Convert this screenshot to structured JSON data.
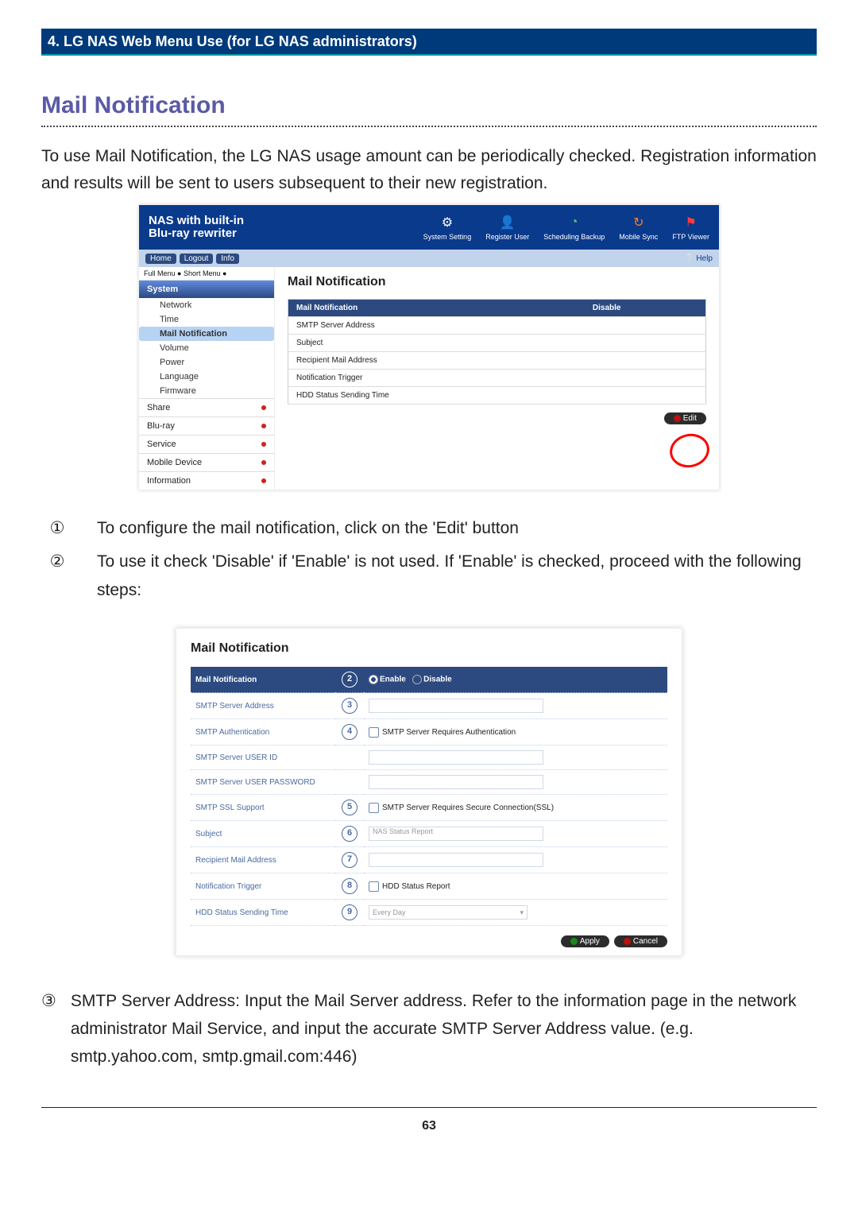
{
  "chapter": "4. LG NAS Web Menu Use (for LG NAS administrators)",
  "section_title": "Mail Notification",
  "lead": "To use Mail Notification, the LG NAS usage amount can be periodically checked. Registration information and results will be sent to users subsequent to their new registration.",
  "shot1": {
    "nas_title1": "NAS with built-in",
    "nas_title2": "Blu-ray rewriter",
    "icons": {
      "sys": "System Setting",
      "reg": "Register User",
      "sched": "Scheduling Backup",
      "sync": "Mobile Sync",
      "ftp": "FTP Viewer"
    },
    "tabs": {
      "home": "Home",
      "logout": "Logout",
      "info": "Info"
    },
    "help": "Help",
    "menu_mode": "Full Menu ●     Short Menu ●",
    "nav": {
      "system": "System",
      "network": "Network",
      "time": "Time",
      "mail": "Mail Notification",
      "volume": "Volume",
      "power": "Power",
      "language": "Language",
      "firmware": "Firmware",
      "share": "Share",
      "bluray": "Blu-ray",
      "service": "Service",
      "mobile": "Mobile Device",
      "information": "Information"
    },
    "main_title": "Mail Notification",
    "table": {
      "hd_name": "Mail Notification",
      "hd_val": "Disable",
      "rows": [
        "SMTP Server Address",
        "Subject",
        "Recipient Mail Address",
        "Notification Trigger",
        "HDD Status Sending Time"
      ]
    },
    "edit_btn": "Edit"
  },
  "steps": [
    {
      "n": "①",
      "t": "To configure the mail notification, click on the 'Edit' button"
    },
    {
      "n": "②",
      "t": "To use it check 'Disable' if 'Enable' is not used. If 'Enable' is checked, proceed with the following steps:"
    }
  ],
  "shot2": {
    "title": "Mail Notification",
    "hd": "Mail Notification",
    "enable": "Enable",
    "disable": "Disable",
    "rows": {
      "smtp_addr": "SMTP Server Address",
      "smtp_auth": "SMTP Authentication",
      "auth_check": "SMTP Server Requires Authentication",
      "user_id": "SMTP Server USER ID",
      "user_pw": "SMTP Server USER PASSWORD",
      "ssl": "SMTP SSL Support",
      "ssl_check": "SMTP Server Requires Secure Connection(SSL)",
      "subject": "Subject",
      "subject_ph": "NAS Status Report",
      "recip": "Recipient Mail Address",
      "trigger": "Notification Trigger",
      "trigger_check": "HDD Status Report",
      "sendtime": "HDD Status Sending Time",
      "sendtime_val": "Every Day"
    },
    "markers": {
      "m2": "2",
      "m3": "3",
      "m4": "4",
      "m5": "5",
      "m6": "6",
      "m7": "7",
      "m8": "8",
      "m9": "9"
    },
    "apply": "Apply",
    "cancel": "Cancel"
  },
  "para3": {
    "n": "③",
    "t": "SMTP Server Address: Input the Mail Server address. Refer to the information page in the network administrator Mail Service, and input the accurate SMTP Server Address value. (e.g. smtp.yahoo.com, smtp.gmail.com:446)"
  },
  "page_number": "63"
}
